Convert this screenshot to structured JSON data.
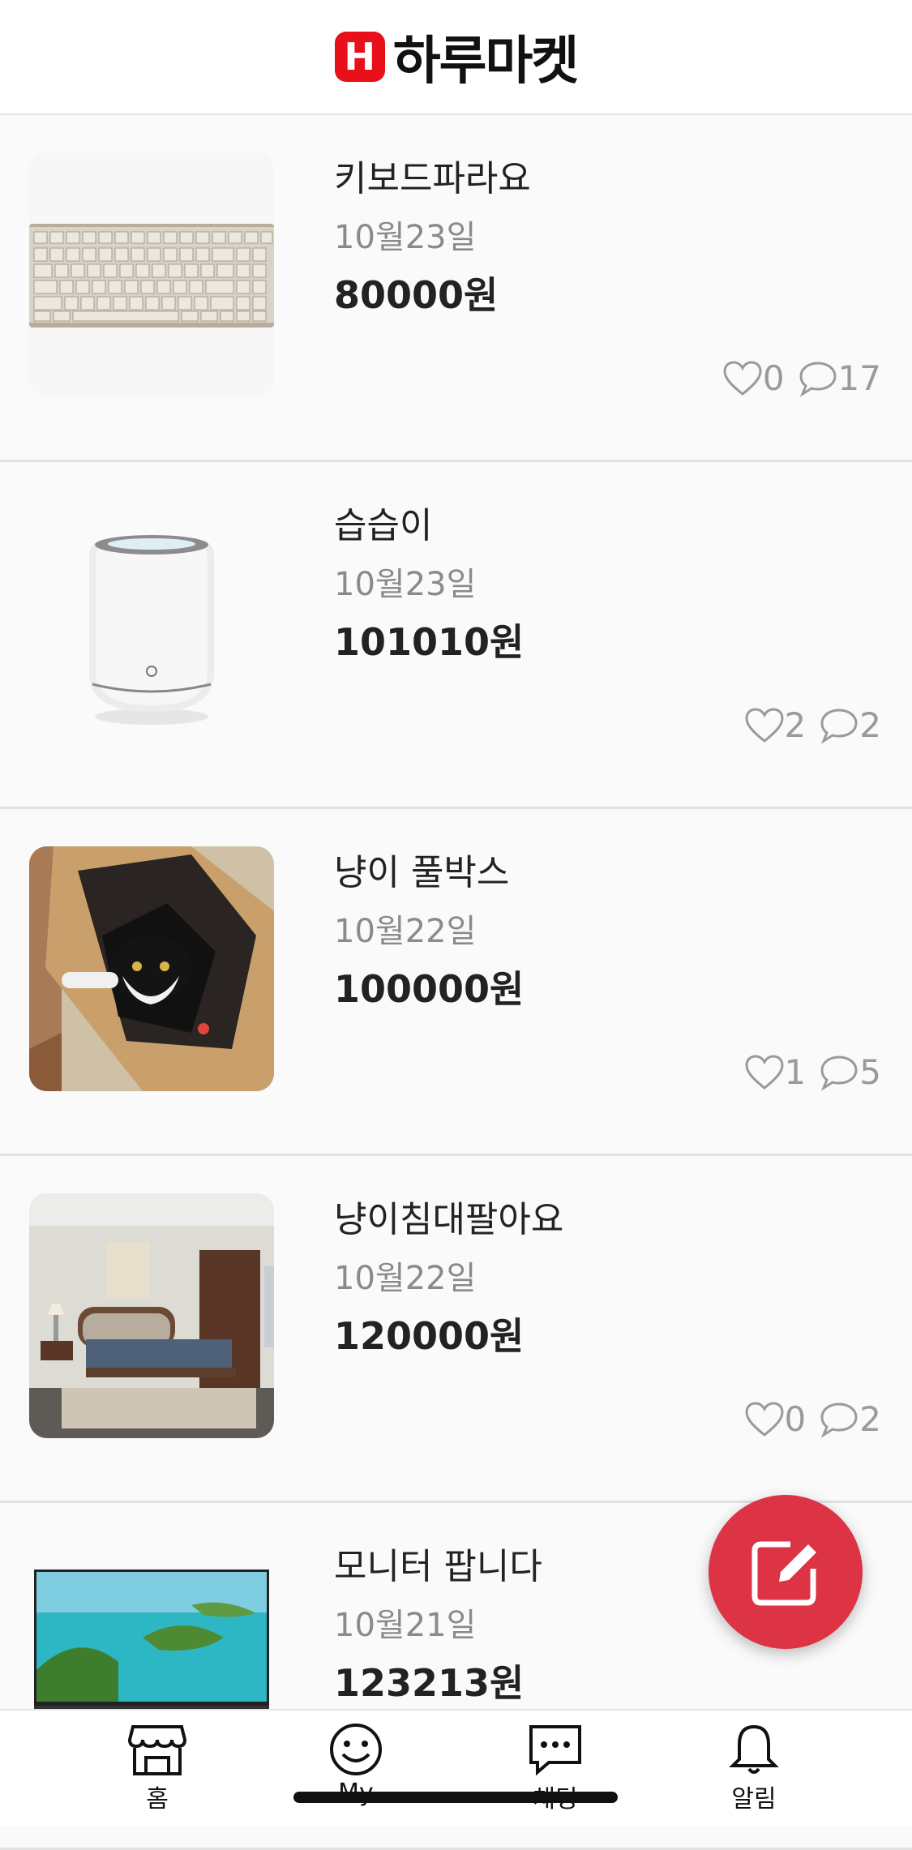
{
  "app": {
    "logo_letter": "H",
    "title": "하루마켓",
    "brand_color": "#e8101a"
  },
  "listings": [
    {
      "title": "키보드파라요",
      "date": "10월23일",
      "price": "80000원",
      "likes": "0",
      "comments": "17",
      "image": "keyboard"
    },
    {
      "title": "습습이",
      "date": "10월23일",
      "price": "101010원",
      "likes": "2",
      "comments": "2",
      "image": "humidifier"
    },
    {
      "title": "냥이 풀박스",
      "date": "10월22일",
      "price": "100000원",
      "likes": "1",
      "comments": "5",
      "image": "cat-in-box"
    },
    {
      "title": "냥이침대팔아요",
      "date": "10월22일",
      "price": "120000원",
      "likes": "0",
      "comments": "2",
      "image": "bed"
    },
    {
      "title": "모니터 팝니다",
      "date": "10월21일",
      "price": "123213원",
      "likes": "",
      "comments": "",
      "image": "monitor"
    }
  ],
  "fab": {
    "icon": "edit-icon",
    "color": "#dc3444"
  },
  "nav": [
    {
      "label": "홈",
      "icon": "store-icon"
    },
    {
      "label": "My",
      "icon": "smile-icon"
    },
    {
      "label": "채팅",
      "icon": "chat-icon"
    },
    {
      "label": "알림",
      "icon": "bell-icon"
    }
  ]
}
